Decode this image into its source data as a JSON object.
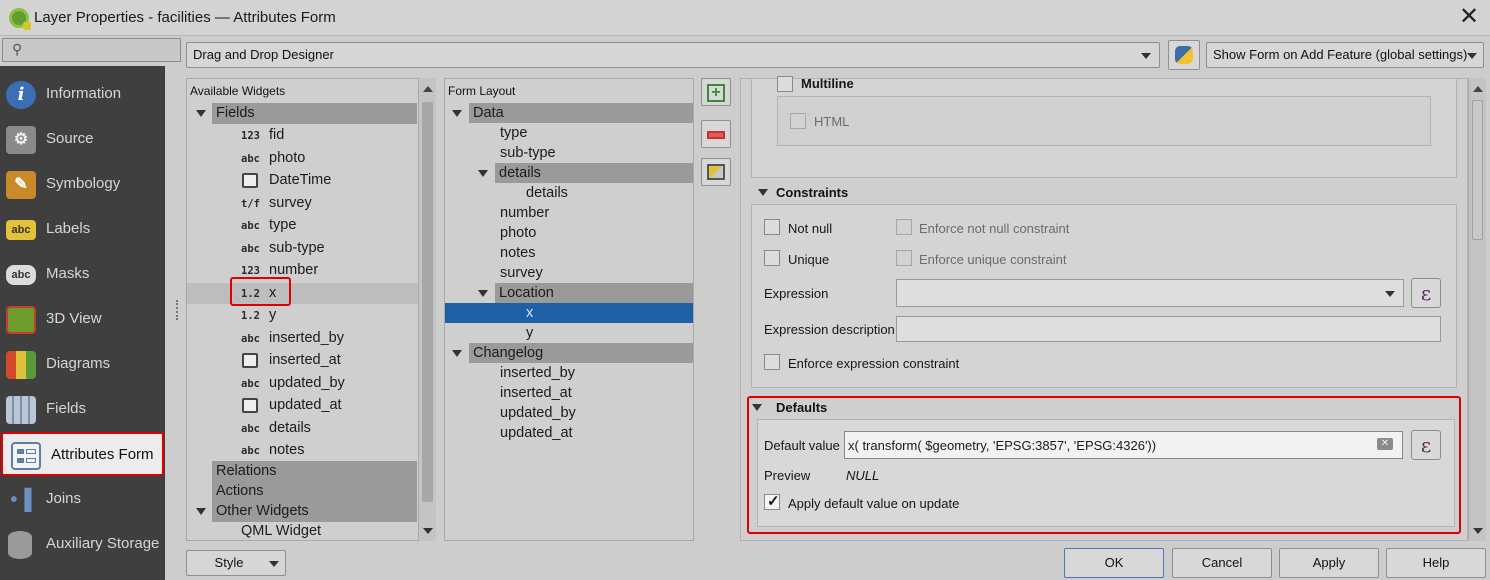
{
  "window": {
    "title": "Layer Properties - facilities — Attributes Form",
    "close_icon": "close-icon"
  },
  "sidebar": {
    "search_icon": "search-icon",
    "items": [
      {
        "label": "Information",
        "icon": "info-icon"
      },
      {
        "label": "Source",
        "icon": "wrench-gear-icon"
      },
      {
        "label": "Symbology",
        "icon": "paintbrush-icon"
      },
      {
        "label": "Labels",
        "icon": "abc-label-icon"
      },
      {
        "label": "Masks",
        "icon": "abc-mask-icon"
      },
      {
        "label": "3D View",
        "icon": "cube-icon"
      },
      {
        "label": "Diagrams",
        "icon": "diagram-icon"
      },
      {
        "label": "Fields",
        "icon": "fields-icon"
      },
      {
        "label": "Attributes Form",
        "icon": "form-icon"
      },
      {
        "label": "Joins",
        "icon": "join-icon"
      },
      {
        "label": "Auxiliary Storage",
        "icon": "database-icon"
      }
    ],
    "selected": "Attributes Form"
  },
  "toolbar": {
    "designer_mode": "Drag and Drop Designer",
    "python_icon": "python-icon",
    "show_form": "Show Form on Add Feature (global settings)"
  },
  "available_widgets": {
    "header": "Available Widgets",
    "fields_group": "Fields",
    "fields": [
      {
        "type": "123",
        "name": "fid"
      },
      {
        "type": "abc",
        "name": "photo"
      },
      {
        "type": "date",
        "name": "DateTime"
      },
      {
        "type": "t/f",
        "name": "survey"
      },
      {
        "type": "abc",
        "name": "type"
      },
      {
        "type": "abc",
        "name": "sub-type"
      },
      {
        "type": "123",
        "name": "number"
      },
      {
        "type": "1.2",
        "name": "x"
      },
      {
        "type": "1.2",
        "name": "y"
      },
      {
        "type": "abc",
        "name": "inserted_by"
      },
      {
        "type": "date",
        "name": "inserted_at"
      },
      {
        "type": "abc",
        "name": "updated_by"
      },
      {
        "type": "date",
        "name": "updated_at"
      },
      {
        "type": "abc",
        "name": "details"
      },
      {
        "type": "abc",
        "name": "notes"
      }
    ],
    "relations": "Relations",
    "actions": "Actions",
    "other_widgets": "Other Widgets",
    "qml_widget": "QML Widget"
  },
  "form_layout": {
    "header": "Form Layout",
    "rows": [
      {
        "label": "Data",
        "level": 0,
        "group": true,
        "expanded": true
      },
      {
        "label": "type",
        "level": 1
      },
      {
        "label": "sub-type",
        "level": 1
      },
      {
        "label": "details",
        "level": 1,
        "group": true,
        "expanded": true
      },
      {
        "label": "details",
        "level": 2
      },
      {
        "label": "number",
        "level": 1
      },
      {
        "label": "photo",
        "level": 1
      },
      {
        "label": "notes",
        "level": 1
      },
      {
        "label": "survey",
        "level": 1
      },
      {
        "label": "Location",
        "level": 1,
        "group": true,
        "expanded": true
      },
      {
        "label": "x",
        "level": 2,
        "selected": true
      },
      {
        "label": "y",
        "level": 2
      },
      {
        "label": "Changelog",
        "level": 0,
        "group": true,
        "expanded": true
      },
      {
        "label": "inserted_by",
        "level": 1
      },
      {
        "label": "inserted_at",
        "level": 1
      },
      {
        "label": "updated_by",
        "level": 1
      },
      {
        "label": "updated_at",
        "level": 1
      }
    ],
    "tools": [
      "add-container-icon",
      "remove-icon",
      "properties-icon"
    ]
  },
  "properties": {
    "multiline_label": "Multiline",
    "html_label": "HTML",
    "constraints_title": "Constraints",
    "not_null": "Not null",
    "enforce_not_null": "Enforce not null constraint",
    "unique": "Unique",
    "enforce_unique": "Enforce unique constraint",
    "expression_label": "Expression",
    "expression_value": "",
    "expression_description_label": "Expression description",
    "expression_description_value": "",
    "enforce_expression": "Enforce expression constraint",
    "defaults_title": "Defaults",
    "default_value_label": "Default value",
    "default_value": "x( transform( $geometry, 'EPSG:3857', 'EPSG:4326'))",
    "preview_label": "Preview",
    "preview_value": "NULL",
    "apply_default_on_update": "Apply default value on update",
    "apply_default_checked": true,
    "epsilon_symbol": "ε"
  },
  "footer": {
    "style": "Style",
    "ok": "OK",
    "cancel": "Cancel",
    "apply": "Apply",
    "help": "Help"
  }
}
